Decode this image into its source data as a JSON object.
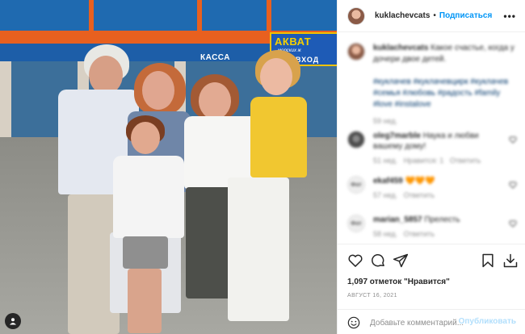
{
  "photo": {
    "sign_kassa": "КАССА",
    "sign_main": "АКВАТ",
    "sign_sub": "морских ж",
    "sign_enter": "ВХОД"
  },
  "header": {
    "username": "kuklachevcats",
    "dot": "•",
    "follow_label": "Подписаться",
    "more_label": "•••"
  },
  "caption": {
    "username": "kuklachevcats",
    "text": "Какое счастье, когда у дочери двое детей.",
    "hashtags": "#куклачев #куклачевцирк #куклачев #семья #любовь #радость #family #love #instalove",
    "time": "59 нед."
  },
  "comments": [
    {
      "username": "oleg7marble",
      "text": "Наука и любви вашему дому!",
      "time": "51 нед.",
      "action": "Нравится: 1",
      "reply": "Ответить",
      "avatar": "photo"
    },
    {
      "username": "ekaf459",
      "text": "🧡🧡🧡",
      "time": "57 нед.",
      "action": "Ответить",
      "reply": "",
      "avatar": "Фот"
    },
    {
      "username": "marian_5857",
      "text": "Прелесть",
      "time": "58 нед.",
      "action": "Ответить",
      "reply": "",
      "avatar": "Фот"
    }
  ],
  "actions": {
    "likes_text": "1,097 отметок \"Нравится\"",
    "date": "АВГУСТ 16, 2021"
  },
  "add_comment": {
    "placeholder": "Добавьте комментарий...",
    "publish_label": "Опубликовать"
  },
  "colors": {
    "accent": "#0095f6",
    "publish_disabled": "#b2dffc",
    "link": "#00376b",
    "muted": "#8e8e8e"
  },
  "icons": [
    "heart-icon",
    "comment-icon",
    "share-icon",
    "bookmark-icon",
    "download-icon",
    "emoji-icon",
    "more-icon"
  ]
}
